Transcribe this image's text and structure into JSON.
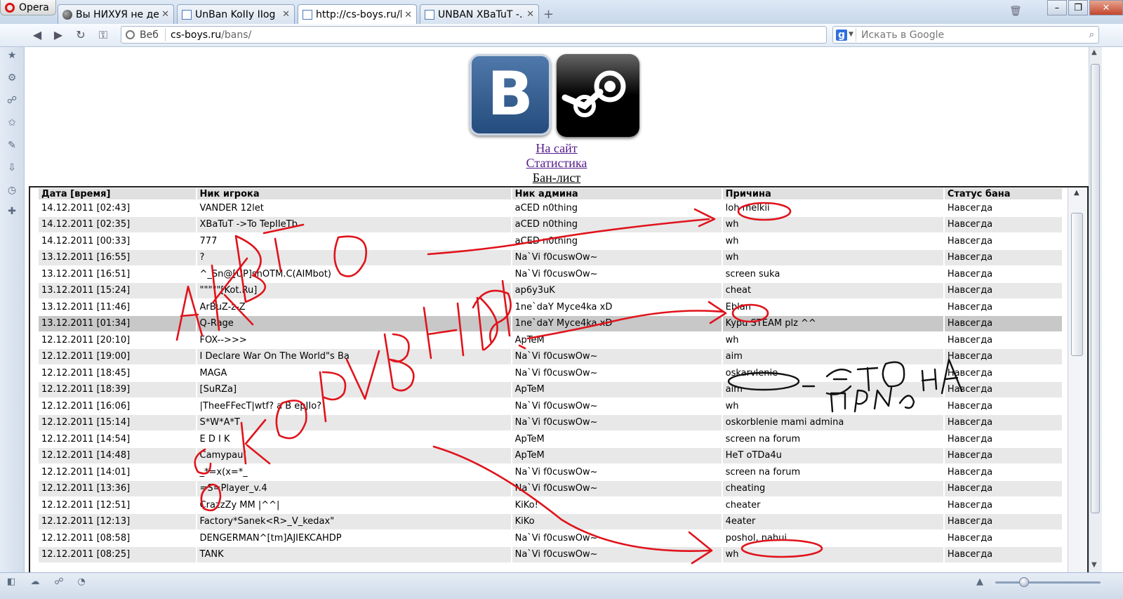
{
  "browser": {
    "menu_label": "Opera",
    "tabs": [
      {
        "title": "Вы НИХУЯ не дел...",
        "active": false
      },
      {
        "title": "UnBan KoIIy IIog ......",
        "active": false
      },
      {
        "title": "http://cs-boys.ru/b...",
        "active": true
      },
      {
        "title": "UNBAN XBaTuT -...",
        "active": false
      }
    ],
    "address": {
      "label": "Веб",
      "host": "cs-boys.ru",
      "path": "/bans/"
    },
    "search_placeholder": "Искать в Google"
  },
  "page": {
    "nav": {
      "site": "На сайт",
      "stats": "Статистика",
      "banlist": "Бан-лист"
    },
    "logo_vk_letter": "B",
    "table": {
      "headers": [
        "Дата [время]",
        "Ник игрока",
        "Ник админа",
        "Причина",
        "Статус бана"
      ],
      "rows": [
        [
          "14.12.2011 [02:43]",
          "VANDER 12let",
          "aCED n0thing",
          "loh melkii",
          "Навсегда"
        ],
        [
          "14.12.2011 [02:35]",
          "XBaTuT ->To TepIIeTb",
          "aCED n0thing",
          "wh",
          "Навсегда"
        ],
        [
          "14.12.2011 [00:33]",
          "777",
          "aCED n0thing",
          "wh",
          "Навсегда"
        ],
        [
          "13.12.2011 [16:55]",
          "?",
          "Na`Vi f0cuswOw~",
          "wh",
          "Навсегда"
        ],
        [
          "13.12.2011 [16:51]",
          "^_Sn@[UP]shOTM.C(AIMbot)",
          "Na`Vi f0cuswOw~",
          "screen suka",
          "Навсегда"
        ],
        [
          "13.12.2011 [15:24]",
          "\"\"\"\"\"[Kot.Ru]",
          "ap6y3uK",
          "cheat",
          "Навсегда"
        ],
        [
          "13.12.2011 [11:46]",
          "ArBuZ-z-Z",
          "1ne`daY Myce4ka xD",
          "Eblan",
          "Навсегда"
        ],
        [
          "13.12.2011 [01:34]",
          "Q-Rage",
          "1ne`daY Myce4ka xD",
          "Kypu STEAM plz ^^",
          "Навсегда"
        ],
        [
          "12.12.2011 [20:10]",
          "FOX-->>>",
          "ApTeM",
          "wh",
          "Навсегда"
        ],
        [
          "12.12.2011 [19:00]",
          "I Declare War On The World\"s Ba",
          "Na`Vi f0cuswOw~",
          "aim",
          "Навсегда"
        ],
        [
          "12.12.2011 [18:45]",
          "MAGA",
          "Na`Vi f0cuswOw~",
          "oskarvlenie",
          "Навсегда"
        ],
        [
          "12.12.2011 [18:39]",
          "[SuRZa]",
          "ApTeM",
          "aim",
          "Навсегда"
        ],
        [
          "12.12.2011 [16:06]",
          "|TheeFFecT|wtf? a B epJIo?",
          "Na`Vi f0cuswOw~",
          "wh",
          "Навсегда"
        ],
        [
          "12.12.2011 [15:14]",
          "S*W*A*T",
          "Na`Vi f0cuswOw~",
          "oskorblenie mami admina",
          "Навсегда"
        ],
        [
          "12.12.2011 [14:54]",
          "E D I K",
          "ApTeM",
          "screen na forum",
          "Навсегда"
        ],
        [
          "12.12.2011 [14:48]",
          "Camypau`",
          "ApTeM",
          "HeT oTDa4u",
          "Навсегда"
        ],
        [
          "12.12.2011 [14:01]",
          "_*=x(x=*_",
          "Na`Vi f0cuswOw~",
          "screen na forum",
          "Навсегда"
        ],
        [
          "12.12.2011 [13:36]",
          "=S=Player_v.4",
          "Na`Vi f0cuswOw~",
          "cheating",
          "Навсегда"
        ],
        [
          "12.12.2011 [12:51]",
          "CrazzZy MM |^^|",
          "KiKo!",
          "cheater",
          "Навсегда"
        ],
        [
          "12.12.2011 [12:13]",
          "Factory*Sanek<R>_V_kedax\"",
          "KiKo",
          "4eater",
          "Навсегда"
        ],
        [
          "12.12.2011 [08:58]",
          "DENGERMAN^[tm]AJIEKCAHDP",
          "Na`Vi f0cuswOw~",
          "poshol, nahui",
          "Навсегда"
        ],
        [
          "12.12.2011 [08:25]",
          "TANK",
          "Na`Vi f0cuswOw~",
          "wh",
          "Навсегда"
        ]
      ]
    }
  },
  "colors": {
    "annotation": "#e0131b",
    "ink": "#111111",
    "link": "#551a8b"
  }
}
